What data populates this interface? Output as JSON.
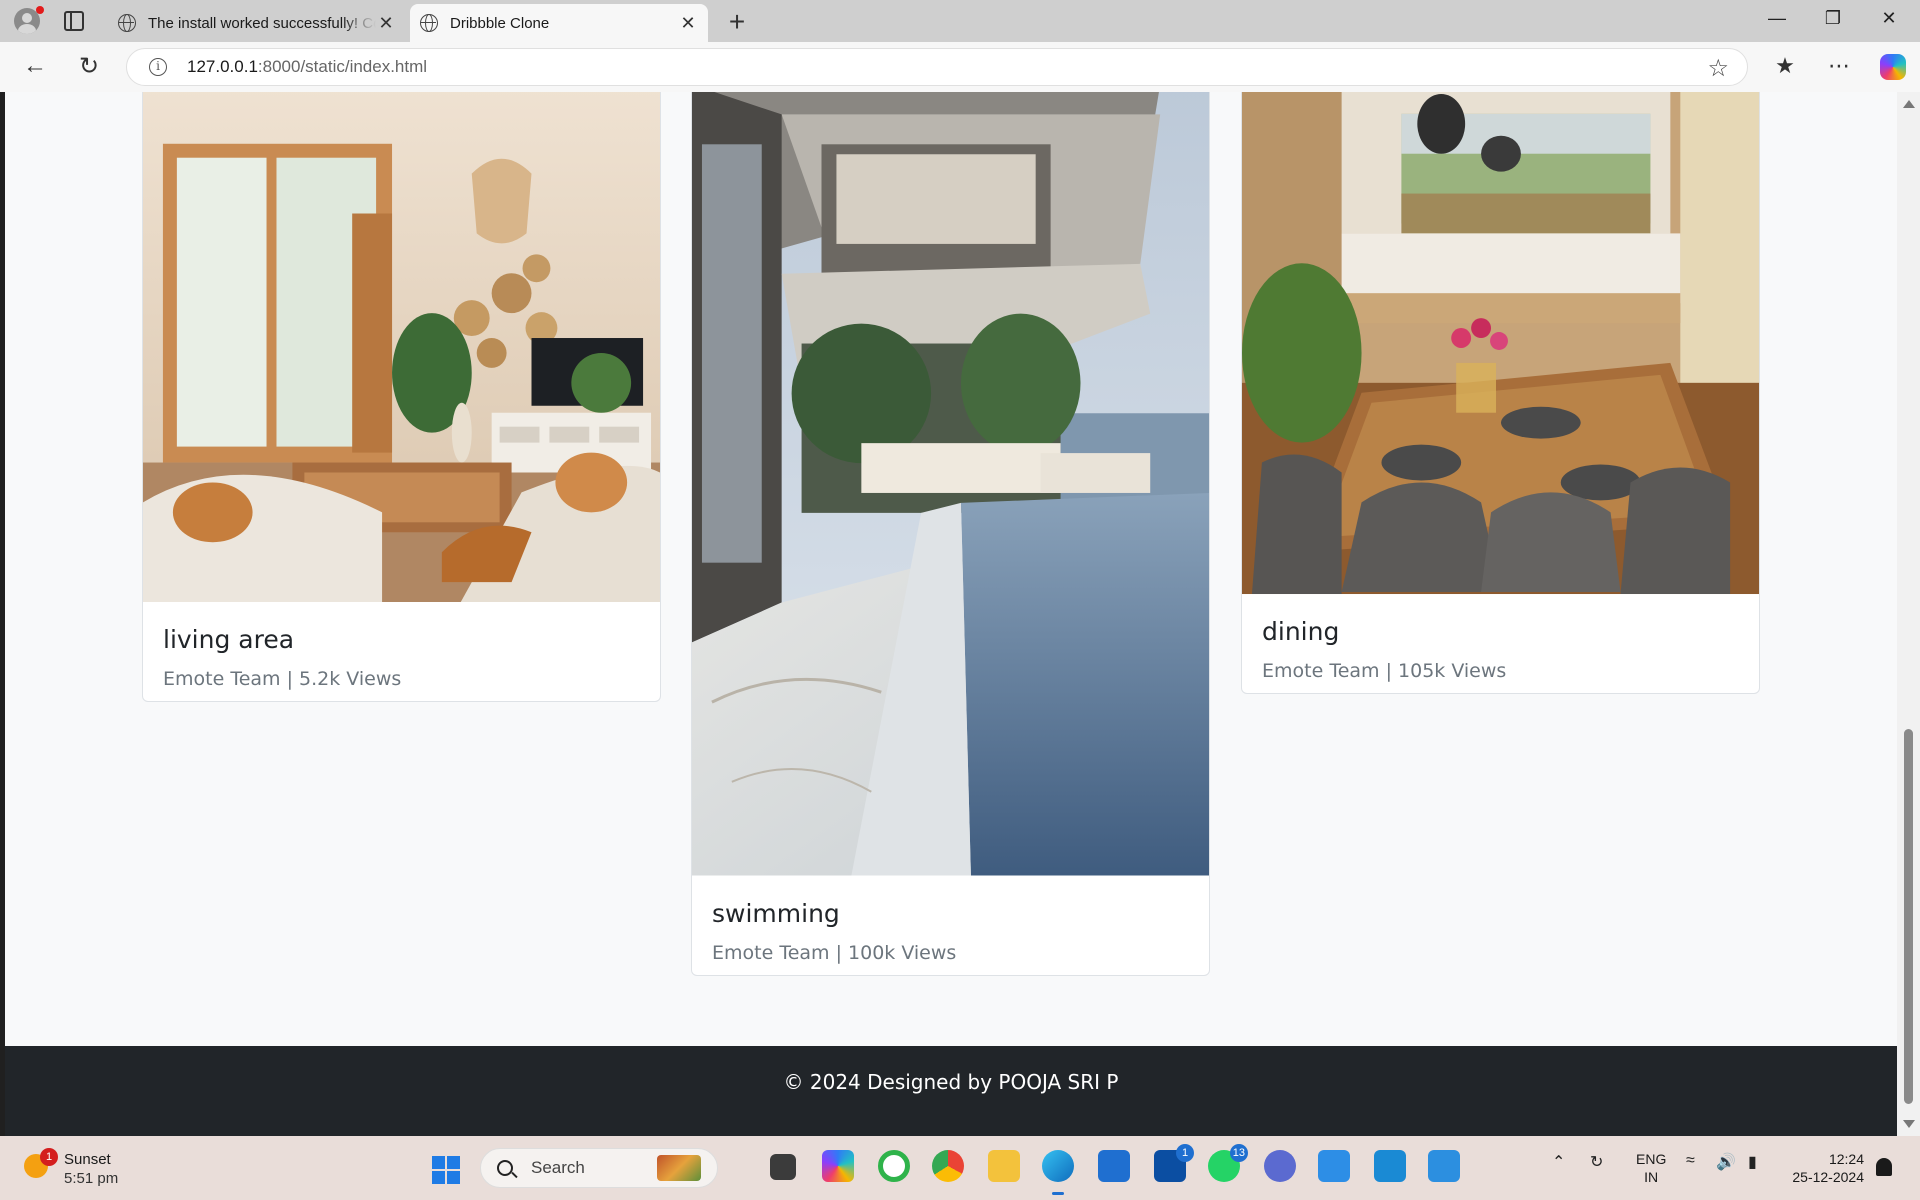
{
  "browser": {
    "tabs": [
      {
        "title": "The install worked successfully! Co",
        "active": false
      },
      {
        "title": "Dribbble Clone",
        "active": true
      }
    ],
    "url_host": "127.0.0.1",
    "url_path": ":8000/static/index.html",
    "new_tab": "+",
    "close_glyph": "✕"
  },
  "cards": [
    {
      "title": "living area",
      "meta": "Emote Team | 5.2k Views",
      "image": "living-room-photo"
    },
    {
      "title": "swimming",
      "meta": "Emote Team | 100k Views",
      "image": "infinity-pool-photo"
    },
    {
      "title": "dining",
      "meta": "Emote Team | 105k Views",
      "image": "dining-kitchen-photo"
    }
  ],
  "footer": {
    "text": "© 2024 Designed by POOJA SRI P"
  },
  "taskbar": {
    "weather": {
      "title": "Sunset",
      "time": "5:51 pm",
      "badge": "1"
    },
    "search_placeholder": "Search",
    "badges": {
      "mail": "1",
      "whatsapp": "13"
    },
    "lang_line1": "ENG",
    "lang_line2": "IN",
    "time": "12:24",
    "date": "25-12-2024"
  },
  "colors": {
    "page_bg": "#f8f9fa",
    "footer_bg": "#212529",
    "card_border": "#dee2e6",
    "muted_text": "#6c757d"
  }
}
